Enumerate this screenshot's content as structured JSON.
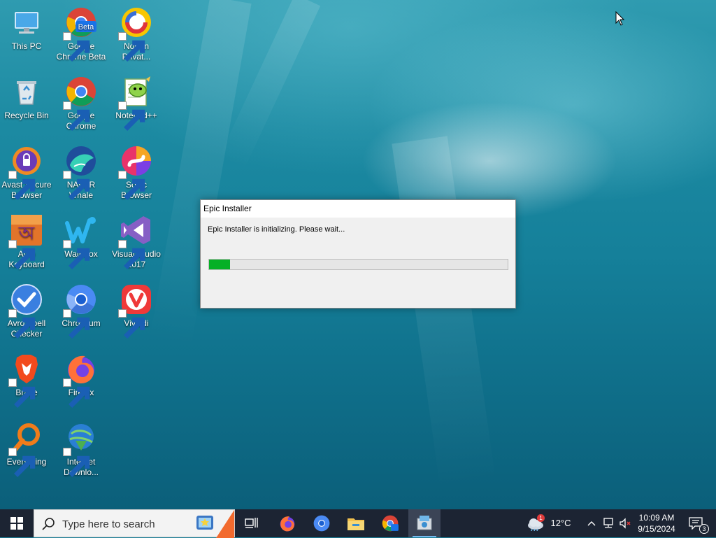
{
  "desktop_icons": [
    {
      "label": "This PC",
      "icon": "this-pc-icon"
    },
    {
      "label": "Google Chrome Beta",
      "icon": "chrome-beta-icon",
      "badge": "Beta"
    },
    {
      "label": "Norton Privat...",
      "icon": "norton-icon"
    },
    {
      "label": "Recycle Bin",
      "icon": "recycle-bin-icon"
    },
    {
      "label": "Google Chrome",
      "icon": "chrome-icon"
    },
    {
      "label": "Notepad++",
      "icon": "notepad-plus-plus-icon"
    },
    {
      "label": "Avast Secure Browser",
      "icon": "avast-icon"
    },
    {
      "label": "NAVER Whale",
      "icon": "whale-icon"
    },
    {
      "label": "Sonic Browser",
      "icon": "sonic-icon"
    },
    {
      "label": "Avro Keyboard",
      "icon": "avro-keyboard-icon"
    },
    {
      "label": "Waterfox",
      "icon": "waterfox-icon"
    },
    {
      "label": "Visual Studio 2017",
      "icon": "visual-studio-icon"
    },
    {
      "label": "Avro Spell Checker",
      "icon": "avro-spell-icon"
    },
    {
      "label": "Chromium",
      "icon": "chromium-icon"
    },
    {
      "label": "Vivaldi",
      "icon": "vivaldi-icon"
    },
    {
      "label": "Brave",
      "icon": "brave-icon"
    },
    {
      "label": "Firefox",
      "icon": "firefox-icon"
    },
    {
      "label": "Everything",
      "icon": "everything-icon"
    },
    {
      "label": "Internet Downlo...",
      "icon": "idm-icon"
    }
  ],
  "dialog": {
    "title": "Epic Installer",
    "message": "Epic Installer is initializing. Please wait...",
    "progress_percent": 7
  },
  "taskbar": {
    "search_placeholder": "Type here to search",
    "weather_temp": "12°C",
    "weather_badge": "1",
    "time": "10:09 AM",
    "date": "9/15/2024",
    "notification_count": "3",
    "pinned": [
      "task-view-icon",
      "firefox-icon",
      "chromium-icon",
      "file-explorer-icon",
      "chrome-beta-icon",
      "installer-icon"
    ]
  },
  "colors": {
    "progress_fill": "#06b025",
    "taskbar_bg": "#1c2433",
    "dialog_bg": "#f0f0f0"
  }
}
